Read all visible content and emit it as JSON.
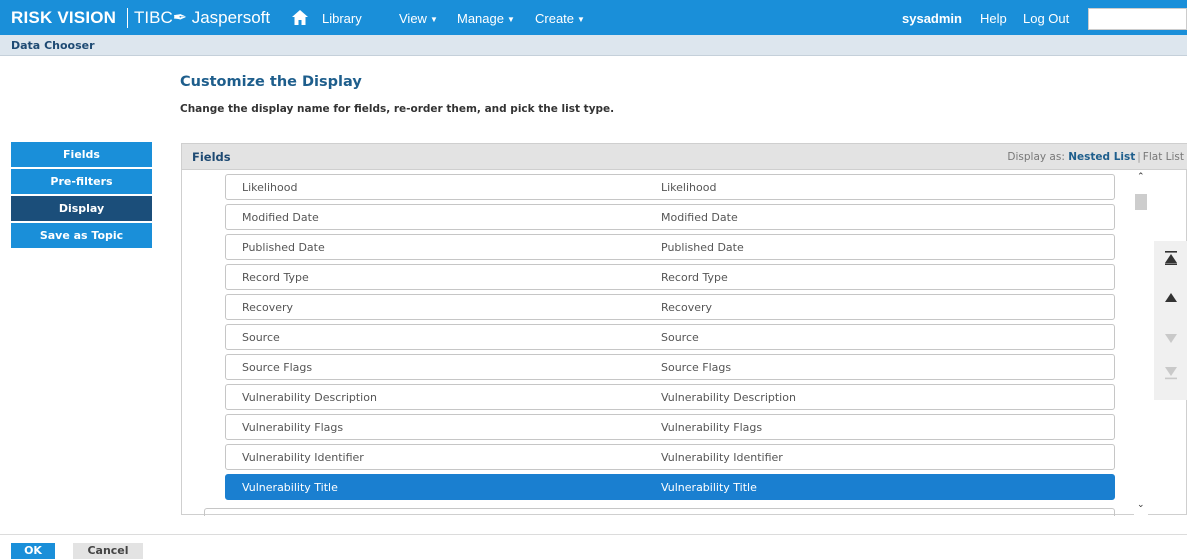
{
  "topbar": {
    "brand": "RISK VISION",
    "product": "TIBC✒ Jaspersoft",
    "nav": {
      "library": "Library",
      "view": "View",
      "manage": "Manage",
      "create": "Create"
    },
    "user": "sysadmin",
    "help": "Help",
    "logout": "Log Out",
    "search_value": ""
  },
  "subbar": {
    "title": "Data Chooser"
  },
  "page": {
    "heading": "Customize the Display",
    "subheading": "Change the display name for fields, re-order them, and pick the list type."
  },
  "steps": [
    {
      "label": "Fields"
    },
    {
      "label": "Pre-filters"
    },
    {
      "label": "Display",
      "active": true
    },
    {
      "label": "Save as Topic"
    }
  ],
  "panel": {
    "title": "Fields",
    "display_as_label": "Display as:",
    "nested_list": "Nested List",
    "flat_list": "Flat List",
    "rows": [
      {
        "field": "Likelihood",
        "display": "Likelihood"
      },
      {
        "field": "Modified Date",
        "display": "Modified Date"
      },
      {
        "field": "Published Date",
        "display": "Published Date"
      },
      {
        "field": "Record Type",
        "display": "Record Type"
      },
      {
        "field": "Recovery",
        "display": "Recovery"
      },
      {
        "field": "Source",
        "display": "Source"
      },
      {
        "field": "Source Flags",
        "display": "Source Flags"
      },
      {
        "field": "Vulnerability Description",
        "display": "Vulnerability Description"
      },
      {
        "field": "Vulnerability Flags",
        "display": "Vulnerability Flags"
      },
      {
        "field": "Vulnerability Identifier",
        "display": "Vulnerability Identifier"
      },
      {
        "field": "Vulnerability Title",
        "display": "Vulnerability Title",
        "selected": true
      }
    ]
  },
  "footer": {
    "ok": "OK",
    "cancel": "Cancel"
  },
  "colors": {
    "accent": "#1a8fd9",
    "active_step": "#1b4e7a",
    "selected_row": "#1a7fd0"
  }
}
